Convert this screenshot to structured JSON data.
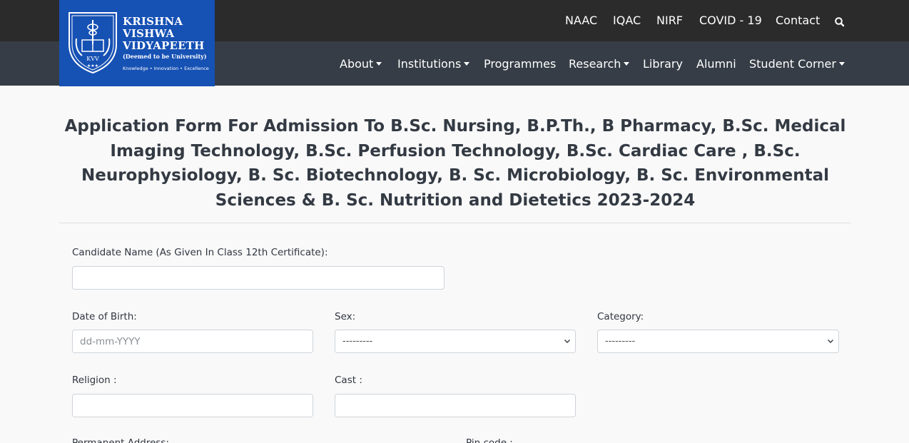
{
  "brand": {
    "name_lines": [
      "KRISHNA",
      "VISHWA",
      "VIDYAPEETH"
    ],
    "deemed": "(Deemed to be University)",
    "motto": "Knowledge • Innovation • Excellence",
    "emblem_text": "KVV",
    "color": "#1651b4"
  },
  "top_nav": {
    "links": [
      "NAAC",
      "IQAC",
      "NIRF",
      "COVID - 19",
      "Contact"
    ],
    "search_icon": "search-icon"
  },
  "main_nav": {
    "items": [
      {
        "label": "About",
        "dropdown": true
      },
      {
        "label": "Institutions",
        "dropdown": true
      },
      {
        "label": "Programmes",
        "dropdown": false
      },
      {
        "label": "Research",
        "dropdown": true
      },
      {
        "label": "Library",
        "dropdown": false
      },
      {
        "label": "Alumni",
        "dropdown": false
      },
      {
        "label": "Student Corner",
        "dropdown": true
      }
    ]
  },
  "page": {
    "title": "Application Form For Admission To B.Sc. Nursing, B.P.Th., B Pharmacy, B.Sc. Medical Imaging Technology, B.Sc. Perfusion Technology, B.Sc. Cardiac Care , B.Sc. Neurophysiology, B. Sc. Biotechnology, B. Sc. Microbiology, B. Sc. Environmental Sciences & B. Sc. Nutrition and Dietetics 2023-2024"
  },
  "form": {
    "candidate_name": {
      "label": "Candidate Name (As Given In Class 12th Certificate):",
      "value": ""
    },
    "dob": {
      "label": "Date of Birth:",
      "placeholder": "dd-mm-YYYY",
      "value": ""
    },
    "sex": {
      "label": "Sex:",
      "selected": "---------"
    },
    "category": {
      "label": "Category:",
      "selected": "---------"
    },
    "religion": {
      "label": "Religion :",
      "value": ""
    },
    "cast": {
      "label": "Cast :",
      "value": ""
    },
    "permanent_address": {
      "label": "Permanent Address:"
    },
    "pin_code": {
      "label": "Pin code :"
    }
  }
}
